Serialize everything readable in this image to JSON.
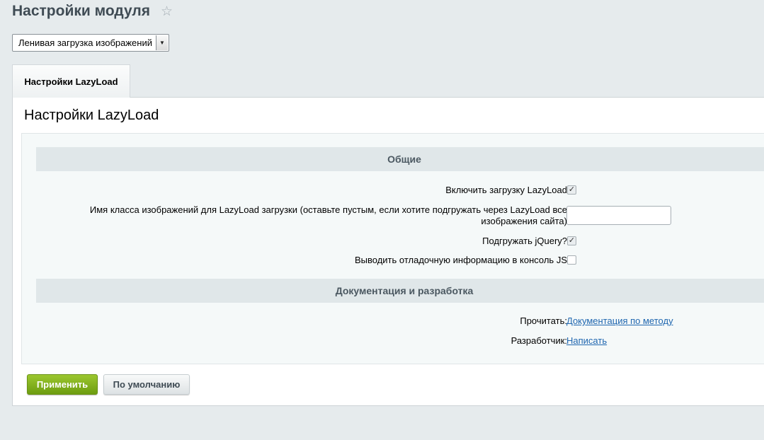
{
  "page": {
    "title": "Настройки модуля",
    "favorite_icon": "star-icon"
  },
  "module_select": {
    "selected": "Ленивая загрузка изображений"
  },
  "tabs": [
    {
      "label": "Настройки LazyLoad"
    }
  ],
  "panel": {
    "title": "Настройки LazyLoad"
  },
  "sections": {
    "general": {
      "title": "Общие",
      "enable_label": "Включить загрузку LazyLoad",
      "enable_checked": true,
      "class_label_line1": "Имя класса изображений для LazyLoad загрузки (оставьте пустым, если хотите подгружать через LazyLoad все",
      "class_label_line2": "изображения сайта)",
      "class_value": "",
      "jquery_label": "Подгружать jQuery?",
      "jquery_checked": true,
      "debug_label": "Выводить отладочную информацию в консоль JS",
      "debug_checked": false
    },
    "docs": {
      "title": "Документация и разработка",
      "read_label": "Прочитать:",
      "read_link": "Документация по методу",
      "dev_label": "Разработчик:",
      "dev_link": "Написать"
    }
  },
  "buttons": {
    "apply": "Применить",
    "default": "По умолчанию"
  },
  "colors": {
    "apply_button": "#86b51f",
    "link": "#2067b0",
    "background": "#e6ebed"
  }
}
